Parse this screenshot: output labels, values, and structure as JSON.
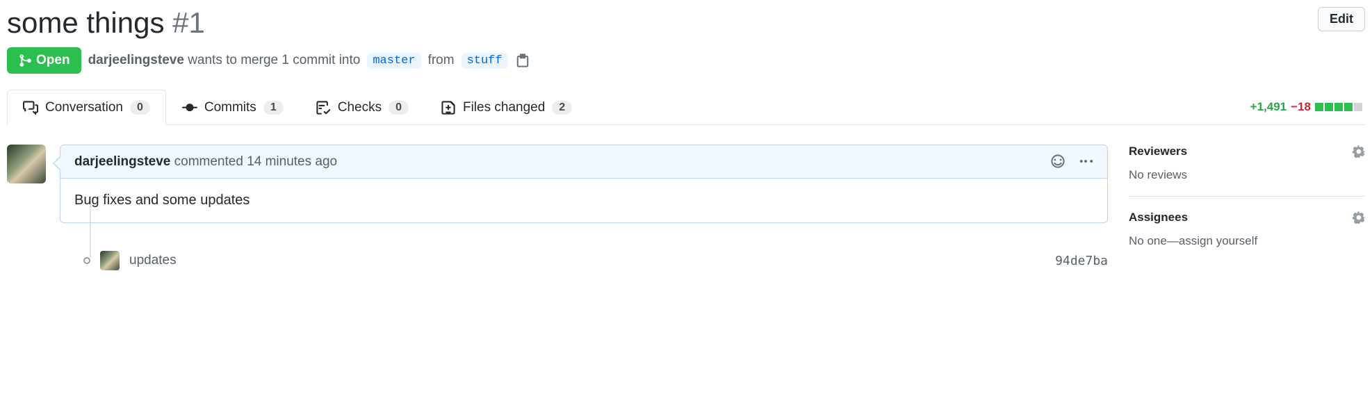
{
  "header": {
    "title": "some things",
    "number": "#1",
    "edit_label": "Edit"
  },
  "state": {
    "label": "Open"
  },
  "merge": {
    "author": "darjeelingsteve",
    "text_before": "wants to merge 1 commit into",
    "base_branch": "master",
    "text_mid": "from",
    "head_branch": "stuff"
  },
  "tabs": {
    "conversation": {
      "label": "Conversation",
      "count": "0"
    },
    "commits": {
      "label": "Commits",
      "count": "1"
    },
    "checks": {
      "label": "Checks",
      "count": "0"
    },
    "files": {
      "label": "Files changed",
      "count": "2"
    }
  },
  "diff": {
    "additions": "+1,491",
    "deletions": "−18"
  },
  "comment": {
    "author": "darjeelingsteve",
    "verb": "commented",
    "time": "14 minutes ago",
    "body": "Bug fixes and some updates"
  },
  "commit": {
    "message": "updates",
    "sha": "94de7ba"
  },
  "sidebar": {
    "reviewers": {
      "title": "Reviewers",
      "body": "No reviews"
    },
    "assignees": {
      "title": "Assignees",
      "body_prefix": "No one—",
      "assign_self": "assign yourself"
    }
  }
}
